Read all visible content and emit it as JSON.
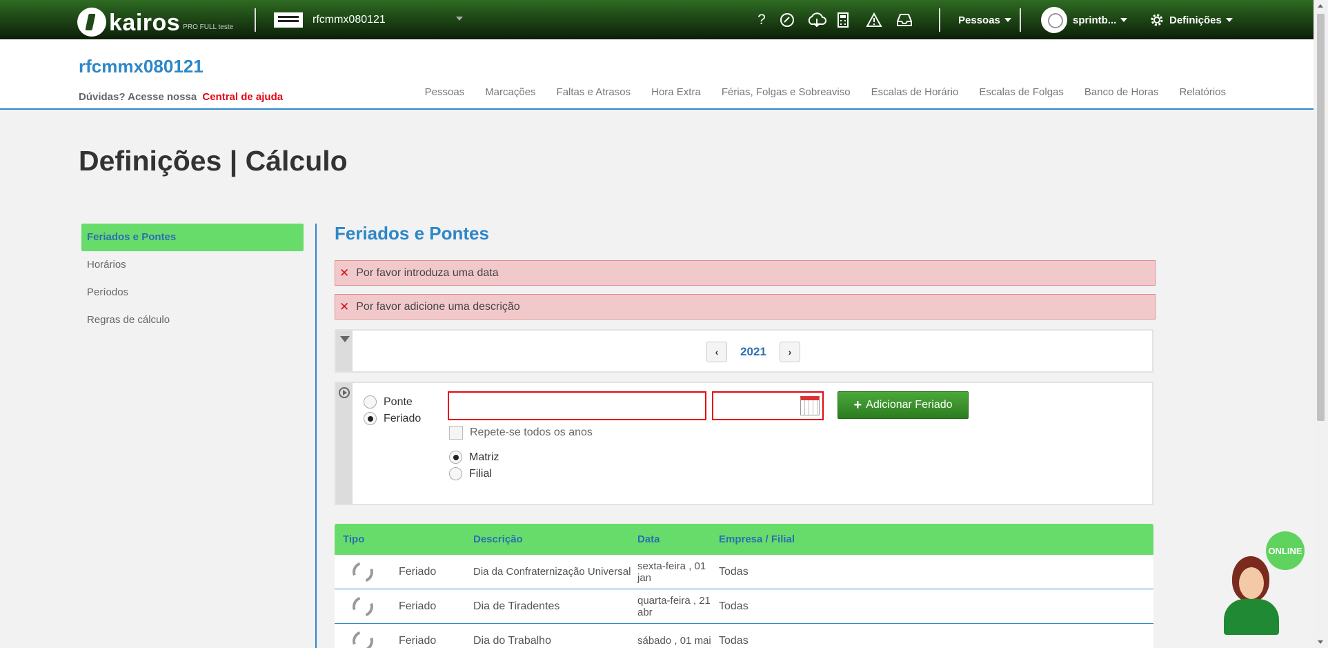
{
  "brand": {
    "name": "kairos",
    "tagline": "PRO FULL teste"
  },
  "topbar": {
    "company": "rfcmmx080121",
    "people_menu": "Pessoas",
    "user_menu": "sprintb...",
    "settings_menu": "Definições",
    "icons": [
      "help-icon",
      "support-icon",
      "cloud-download-icon",
      "calculator-icon",
      "warning-icon",
      "inbox-icon"
    ]
  },
  "header": {
    "company_title": "rfcmmx080121",
    "help_text": "Dúvidas? Acesse nossa",
    "help_link": "Central de ajuda",
    "nav": [
      "Pessoas",
      "Marcações",
      "Faltas e Atrasos",
      "Hora Extra",
      "Férias, Folgas e Sobreaviso",
      "Escalas de Horário",
      "Escalas de Folgas",
      "Banco de Horas",
      "Relatórios"
    ]
  },
  "page": {
    "title": "Definições | Cálculo"
  },
  "sidebar": {
    "items": [
      {
        "label": "Feriados e Pontes",
        "active": true
      },
      {
        "label": "Horários",
        "active": false
      },
      {
        "label": "Períodos",
        "active": false
      },
      {
        "label": "Regras de cálculo",
        "active": false
      }
    ]
  },
  "main": {
    "section_title": "Feriados e Pontes",
    "alerts": [
      "Por favor introduza uma data",
      "Por favor adicione uma descrição"
    ],
    "filter": {
      "year": "2021",
      "prev": "‹",
      "next": "›"
    },
    "form": {
      "type_options": [
        "Ponte",
        "Feriado"
      ],
      "selected_type": "Feriado",
      "description_value": "",
      "date_value": "",
      "repeat_label": "Repete-se todos os anos",
      "scope_options": [
        "Matriz",
        "Filial"
      ],
      "selected_scope": "Matriz",
      "add_button": "Adicionar Feriado"
    },
    "table": {
      "columns": [
        "Tipo",
        "Descrição",
        "Data",
        "Empresa / Filial"
      ],
      "rows": [
        {
          "type": "Feriado",
          "description": "Dia da Confraternização Universal",
          "date": "sexta-feira , 01 jan",
          "scope": "Todas"
        },
        {
          "type": "Feriado",
          "description": "Dia de Tiradentes",
          "date": "quarta-feira , 21 abr",
          "scope": "Todas"
        },
        {
          "type": "Feriado",
          "description": "Dia do Trabalho",
          "date": "sábado , 01 mai",
          "scope": "Todas"
        }
      ]
    }
  },
  "chat": {
    "badge": "ONLINE"
  },
  "colors": {
    "accent_blue": "#2d87c8",
    "active_green": "#68dc6a",
    "error_red": "#e30613",
    "alert_bg": "#f2c9cb",
    "button_green": "#3a9a2c"
  }
}
